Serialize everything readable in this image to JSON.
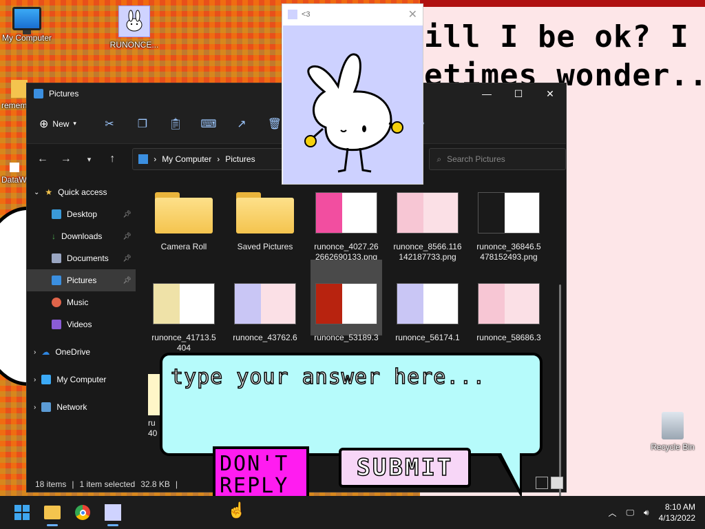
{
  "desktop": {
    "big_text_line1": "ill I be ok? I",
    "big_text_line2": "etimes wonder...",
    "icons": {
      "my_computer": "My Computer",
      "runonce": "RUNONCE...",
      "remember_partial": "remem",
      "dataw_partial": "DataW"
    },
    "recycle_bin": "Recycle Bin"
  },
  "viewer": {
    "title": "<3"
  },
  "explorer": {
    "title": "Pictures",
    "toolbar": {
      "new_label": "New"
    },
    "breadcrumb": {
      "root": "My Computer",
      "current": "Pictures"
    },
    "search_placeholder": "Search Pictures",
    "sidebar": {
      "quick_access": "Quick access",
      "items": [
        "Desktop",
        "Downloads",
        "Documents",
        "Pictures",
        "Music",
        "Videos"
      ],
      "onedrive": "OneDrive",
      "my_computer": "My Computer",
      "network": "Network"
    },
    "files": [
      "Camera Roll",
      "Saved Pictures",
      "runonce_4027.262662690133.png",
      "runonce_8566.116142187733.png",
      "runonce_36846.5478152493.png",
      "runonce_41713.5404",
      "runonce_43762.6",
      "runonce_53189.3",
      "runonce_56174.1",
      "runonce_58686.3",
      "ru",
      "40"
    ],
    "status": {
      "items": "18 items",
      "selected": "1 item selected",
      "size": "32.8 KB"
    }
  },
  "dialog": {
    "input_placeholder": "type your answer here...",
    "dont_reply_label": "DON'T REPLY",
    "submit_label": "SUBMIT"
  },
  "taskbar": {
    "time": "8:10 AM",
    "date": "4/13/2022"
  },
  "colors": {
    "speech_bg": "#b6fbfb",
    "dont_reply_bg": "#ff1cf0",
    "submit_bg": "#f7d6f7"
  }
}
